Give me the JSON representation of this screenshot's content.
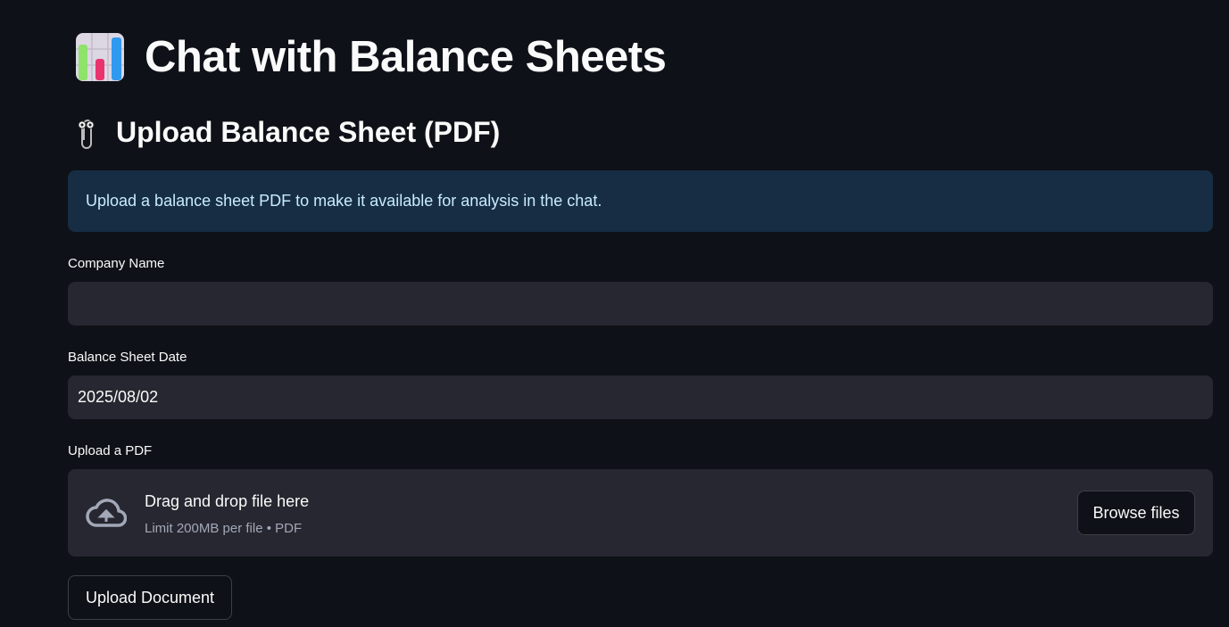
{
  "header": {
    "title": "Chat with Balance Sheets",
    "title_icon": "bar-chart-emoji"
  },
  "section": {
    "title": "Upload Balance Sheet (PDF)",
    "icon": "paperclip-emoji"
  },
  "info": {
    "text": "Upload a balance sheet PDF to make it available for analysis in the chat."
  },
  "form": {
    "company_name": {
      "label": "Company Name",
      "value": ""
    },
    "date": {
      "label": "Balance Sheet Date",
      "value": "2025/08/02"
    },
    "upload": {
      "label": "Upload a PDF",
      "drop_text": "Drag and drop file here",
      "limit_text": "Limit 200MB per file • PDF",
      "browse_label": "Browse files",
      "icon": "cloud-upload-icon"
    },
    "submit_label": "Upload Document"
  },
  "colors": {
    "background": "#0e1117",
    "input": "#262730",
    "info_bg": "#172d43",
    "info_text": "#c7ebff"
  }
}
